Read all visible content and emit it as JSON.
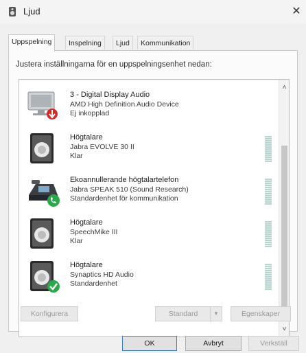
{
  "window": {
    "title": "Ljud",
    "close_glyph": "✕"
  },
  "tabs": [
    {
      "label": "Uppspelning"
    },
    {
      "label": "Inspelning"
    },
    {
      "label": "Ljud"
    },
    {
      "label": "Kommunikation"
    }
  ],
  "instruction": "Justera inställningarna för en uppspelningsenhet nedan:",
  "devices": [
    {
      "name": "3 - Digital Display Audio",
      "description": "AMD High Definition Audio Device",
      "status": "Ej inkopplad",
      "icon": "monitor-icon",
      "badge": "disconnected-badge"
    },
    {
      "name": "Högtalare",
      "description": "Jabra EVOLVE 30 II",
      "status": "Klar",
      "icon": "speaker-icon",
      "badge": ""
    },
    {
      "name": "Ekoannullerande högtalartelefon",
      "description": "Jabra SPEAK 510 (Sound Research)",
      "status": "Standardenhet för kommunikation",
      "icon": "speakerphone-icon",
      "badge": "default-communication-badge"
    },
    {
      "name": "Högtalare",
      "description": "SpeechMike III",
      "status": "Klar",
      "icon": "speaker-icon",
      "badge": ""
    },
    {
      "name": "Högtalare",
      "description": "Synaptics HD Audio",
      "status": "Standardenhet",
      "icon": "speaker-icon",
      "badge": "default-device-badge"
    }
  ],
  "scroll": {
    "up": "˄",
    "down": "˅"
  },
  "buttons": {
    "configure": "Konfigurera",
    "set_default": "Standard",
    "properties": "Egenskaper",
    "ok": "OK",
    "cancel": "Avbryt",
    "apply": "Verkställ",
    "dropdown_glyph": "▼"
  },
  "colors": {
    "accent": "#3a7bd5",
    "ok_badge": "#2aa84a",
    "error_badge": "#d42a2a"
  }
}
